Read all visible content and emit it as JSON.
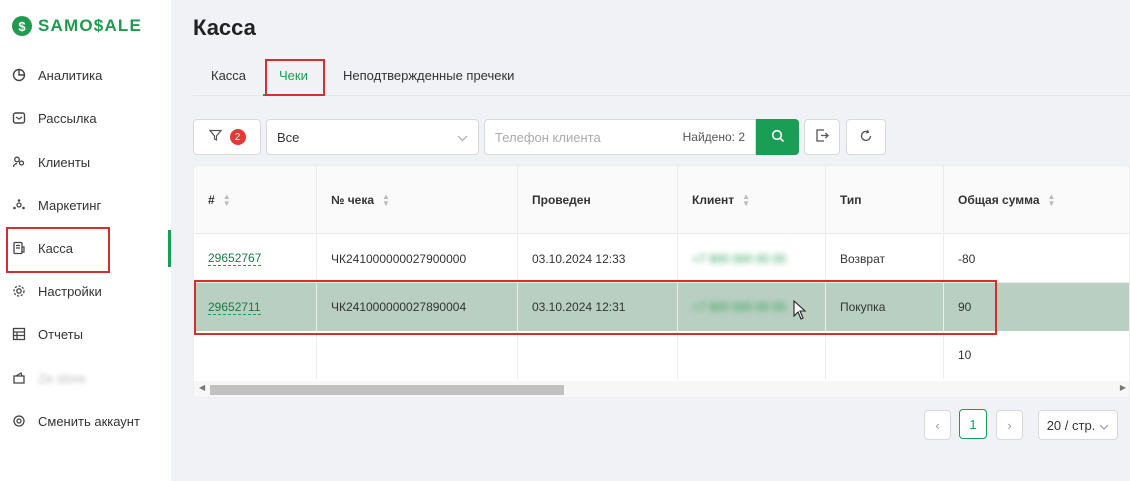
{
  "logo": {
    "mark": "$",
    "text": "SAMO$ALE"
  },
  "sidebar": {
    "items": [
      {
        "label": "Аналитика",
        "icon": "analytics-icon"
      },
      {
        "label": "Рассылка",
        "icon": "mailing-icon"
      },
      {
        "label": "Клиенты",
        "icon": "clients-icon"
      },
      {
        "label": "Маркетинг",
        "icon": "marketing-icon"
      },
      {
        "label": "Касса",
        "icon": "cashbox-icon"
      },
      {
        "label": "Настройки",
        "icon": "settings-icon"
      },
      {
        "label": "Отчеты",
        "icon": "reports-icon"
      },
      {
        "label": "Ze store",
        "icon": "wallet-icon"
      },
      {
        "label": "Сменить аккаунт",
        "icon": "switch-account-icon"
      }
    ]
  },
  "page": {
    "title": "Касса"
  },
  "tabs": [
    {
      "label": "Касса"
    },
    {
      "label": "Чеки"
    },
    {
      "label": "Неподтвержденные пречеки"
    }
  ],
  "toolbar": {
    "filter_badge": "2",
    "select_value": "Все",
    "search_placeholder": "Телефон клиента",
    "found_text": "Найдено: 2"
  },
  "table": {
    "headers": [
      "#",
      "№ чека",
      "Проведен",
      "Клиент",
      "Тип",
      "Общая сумма"
    ],
    "rows": [
      {
        "id": "29652767",
        "check": "ЧК241000000027900000",
        "date": "03.10.2024 12:33",
        "client": "+7 900 000 00 00",
        "type": "Возврат",
        "sum": "-80"
      },
      {
        "id": "29652711",
        "check": "ЧК241000000027890004",
        "date": "03.10.2024 12:31",
        "client": "+7 900 000 00 00",
        "type": "Покупка",
        "sum": "90"
      }
    ],
    "footer_sum": "10"
  },
  "pagination": {
    "current": "1",
    "page_size": "20 / стр."
  },
  "colors": {
    "accent": "#1a9e55",
    "selected_row": "#b9cfc2",
    "highlight": "#d32f2f"
  }
}
